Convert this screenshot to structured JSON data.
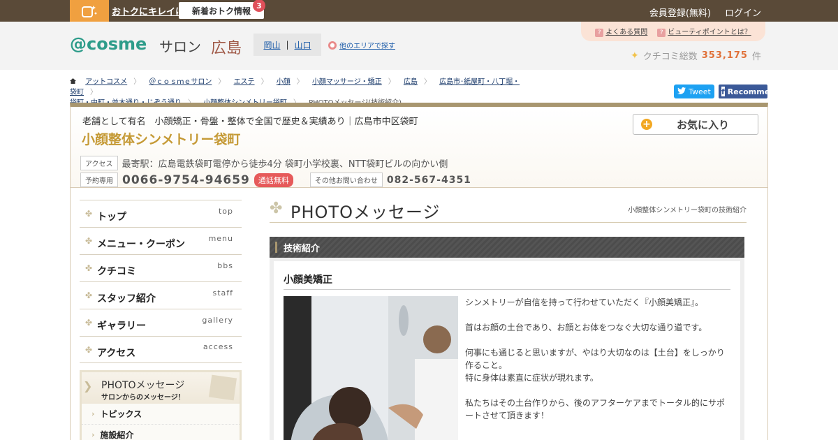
{
  "topbar": {
    "promo_text": "おトクにキレイになる情報が満載！",
    "promo_button": "新着おトク情報",
    "promo_badge": "3",
    "signup": "会員登録(無料)",
    "login": "ログイン"
  },
  "header": {
    "logo": "@cosme",
    "logo_salon": "サロン",
    "area": "広島",
    "area_links": [
      "岡山",
      "山口"
    ],
    "area_sep": "|",
    "other_area": "他のエリアで探す",
    "help_links": [
      "よくある質問",
      "ビューティポイントとは？"
    ],
    "review_label": "クチコミ総数",
    "review_count": "353,175",
    "review_unit": "件"
  },
  "breadcrumb": {
    "items": [
      "アットコスメ",
      "＠ｃｏｓｍｅサロン",
      "エステ",
      "小顔",
      "小顔マッサージ・矯正",
      "広島",
      "広島市･紙屋町・八丁堀・袋町",
      "袋町・中町・並木通り・じぞう通り",
      "小顔整体シンメトリー袋町"
    ],
    "current": "PHOTOメッセージ(技術紹介)"
  },
  "social": {
    "tweet": "Tweet",
    "facebook": "Recommend"
  },
  "salon": {
    "catch": "老舗として有名　小顔矯正・骨盤・整体で全国で歴史＆実績あり｜広島市中区袋町",
    "name": "小顔整体シンメトリー袋町",
    "favorite": "お気に入り",
    "access_tag": "アクセス",
    "access_text": "最寄駅：広島電鉄袋町電停から徒歩4分 袋町小学校裏、NTT袋町ビルの向かい側",
    "reserve_tag": "予約専用",
    "phone": "0066-9754-94659",
    "free_badge": "通話無料",
    "other_tag": "その他お問い合わせ",
    "phone2": "082-567-4351"
  },
  "sidebar": {
    "items": [
      {
        "label": "トップ",
        "en": "top"
      },
      {
        "label": "メニュー・クーポン",
        "en": "menu"
      },
      {
        "label": "クチコミ",
        "en": "bbs"
      },
      {
        "label": "スタッフ紹介",
        "en": "staff"
      },
      {
        "label": "ギャラリー",
        "en": "gallery"
      },
      {
        "label": "アクセス",
        "en": "access"
      }
    ],
    "photo_card_title": "PHOTOメッセージ",
    "photo_card_sub": "サロンからのメッセージ！",
    "sub_items": [
      "トピックス",
      "施設紹介"
    ]
  },
  "main": {
    "page_title": "PHOTOメッセージ",
    "page_sub": "小顔整体シンメトリー袋町の技術紹介",
    "section": "技術紹介",
    "content_title": "小顔美矯正",
    "paragraphs": [
      "シンメトリーが自信を持って行わせていただく『小顔美矯正』。",
      "首はお顔の土台であり、お顔とお体をつなぐ大切な通り道です。",
      "何事にも通じると思いますが、やはり大切なのは【土台】をしっかり作ること。\n特に身体は素直に症状が現れます。",
      "私たちはその土台作りから、後のアフターケアまでトータル的にサポートさせて頂きます！"
    ]
  },
  "colors": {
    "topbar": "#5a4a38",
    "gold": "#c59a36",
    "brand": "#2e9c8a",
    "accent": "#e07038"
  }
}
